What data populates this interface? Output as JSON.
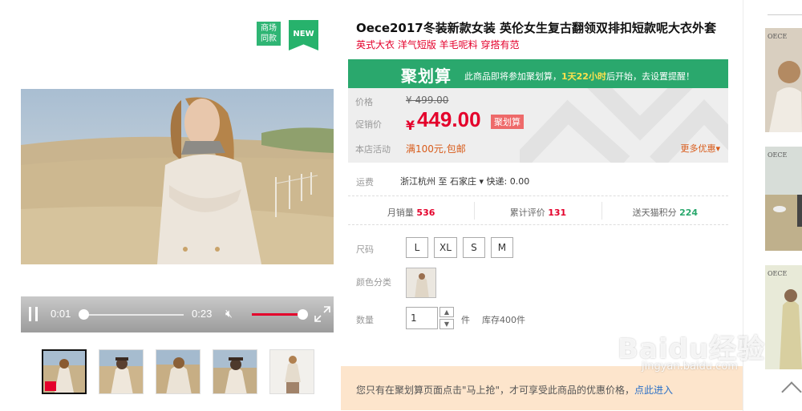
{
  "badges": {
    "mall": "商场\n同款",
    "mall_line1": "商场",
    "mall_line2": "同款",
    "new": "NEW"
  },
  "player": {
    "current_time": "0:01",
    "total_time": "0:23"
  },
  "product": {
    "title": "Oece2017冬装新款女装 英伦女生复古翻领双排扣短款呢大衣外套",
    "subtitle": "英式大衣 洋气短版 羊毛呢料 穿搭有范"
  },
  "banner": {
    "logo": "聚划算",
    "text_before": "此商品即将参加聚划算，",
    "highlight": "1天22小时",
    "text_after": "后开始，去设置提醒！"
  },
  "price": {
    "price_label": "价格",
    "original": "¥ 499.00",
    "promo_label": "促销价",
    "currency": "¥",
    "sale": "449.00",
    "sale_tag": "聚划算",
    "activity_label": "本店活动",
    "activity": "满100元,包邮",
    "more": "更多优惠"
  },
  "shipping": {
    "label": "运费",
    "value": "浙江杭州 至 石家庄 ▾  快递: 0.00"
  },
  "stats": {
    "monthly_label": "月销量",
    "monthly": "536",
    "reviews_label": "累计评价",
    "reviews": "131",
    "points_label": "送天猫积分",
    "points": "224"
  },
  "options": {
    "size_label": "尺码",
    "sizes": [
      "L",
      "XL",
      "S",
      "M"
    ],
    "color_label": "颜色分类",
    "qty_label": "数量",
    "qty_value": "1",
    "unit": "件",
    "stock": "库存400件"
  },
  "notice": {
    "text": "您只有在聚划算页面点击\"马上抢\"，才可享受此商品的优惠价格，",
    "link": "点此进入"
  },
  "watermark": {
    "main": "Baidu经验",
    "sub": "jingyan.baidu.com"
  },
  "colors": {
    "accent_green": "#2aa86d",
    "price_red": "#e4002b",
    "notice_bg": "#fde5cc"
  }
}
